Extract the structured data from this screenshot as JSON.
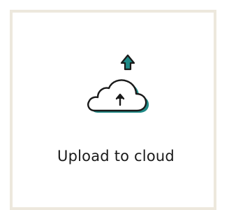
{
  "tile": {
    "label": "Upload to cloud",
    "icon": "cloud-upload-icon",
    "colors": {
      "outline": "#1a1a1a",
      "accent": "#1f8a87",
      "border": "#ede8dd"
    }
  }
}
